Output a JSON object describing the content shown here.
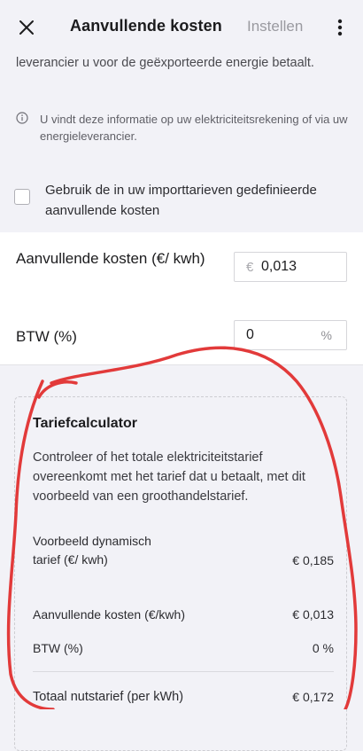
{
  "header": {
    "title": "Aanvullende kosten",
    "action_label": "Instellen",
    "close_icon": "close-icon",
    "more_icon": "more-vertical-icon"
  },
  "intro_cut_text": "leverancier u voor de geëxporteerde energie betaalt.",
  "info_text": "U vindt deze informatie op uw elektriciteitsrekening of via uw energieleverancier.",
  "use_import_checkbox": {
    "label": "Gebruik de in uw importtarieven gedefinieerde aanvullende kosten",
    "checked": false
  },
  "fields": {
    "additional_costs": {
      "label": "Aanvullende kosten (€/ kwh)",
      "prefix": "€",
      "value": "0,013"
    },
    "vat": {
      "label": "BTW (%)",
      "value": "0",
      "suffix": "%"
    }
  },
  "calculator": {
    "title": "Tariefcalculator",
    "description": "Controleer of het totale elektriciteitstarief overeenkomt met het tarief dat u betaalt, met dit voorbeeld van een groothandelstarief.",
    "lines": [
      {
        "label": "Voorbeeld dynamisch tarief (€/ kwh)",
        "value": "€ 0,185"
      },
      {
        "label": "Aanvullende kosten (€/kwh)",
        "value": "€ 0,013"
      },
      {
        "label": "BTW (%)",
        "value": "0 %"
      }
    ],
    "total": {
      "label": "Totaal nutstarief (per kWh)",
      "value": "€ 0,172"
    }
  },
  "colors": {
    "background": "#f2f2f7",
    "annotation_stroke": "#e23a3a"
  }
}
